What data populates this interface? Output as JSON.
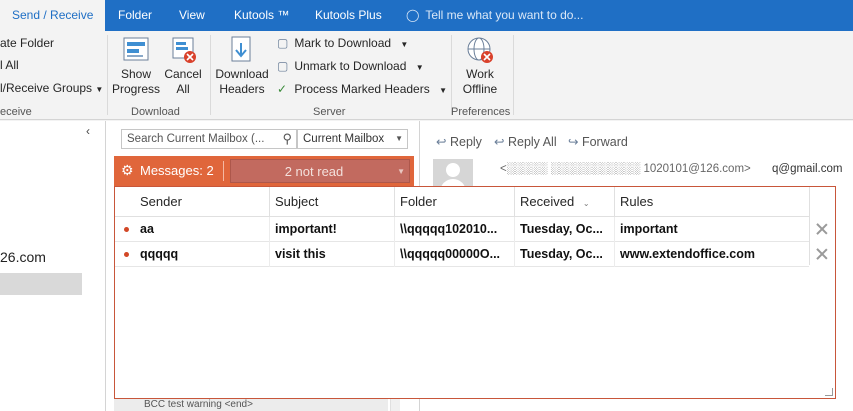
{
  "tabs": [
    {
      "label": "Send / Receive",
      "active": true
    },
    {
      "label": "Folder"
    },
    {
      "label": "View"
    },
    {
      "label": "Kutools ™"
    },
    {
      "label": "Kutools Plus"
    }
  ],
  "tell_me": "Tell me what you want to do...",
  "ribbon": {
    "create_folder": "ate Folder",
    "send_all": "l All",
    "receive_groups": "l/Receive Groups",
    "receive_group_label": "eceive",
    "show_progress_1": "Show",
    "show_progress_2": "Progress",
    "cancel_all_1": "Cancel",
    "cancel_all_2": "All",
    "download_group": "Download",
    "download_headers_1": "Download",
    "download_headers_2": "Headers",
    "mark_to_download": "Mark to Download",
    "unmark_to_download": "Unmark to Download",
    "process_marked_headers": "Process Marked Headers",
    "server_group": "Server",
    "work_offline_1": "Work",
    "work_offline_2": "Offline",
    "preferences_group": "Preferences"
  },
  "left_pane": {
    "account_suffix": "26.com"
  },
  "search": {
    "placeholder": "Search Current Mailbox (...",
    "scope": "Current Mailbox"
  },
  "reading": {
    "reply": "Reply",
    "reply_all": "Reply All",
    "forward": "Forward",
    "recipient": "q@gmail.com",
    "sender_blurred": "<░░░░░ ░░░░░░░░░░░ 1020101@126.com>"
  },
  "kutools_panel": {
    "title": "Messages: 2",
    "filter_value": "2 not read",
    "columns": [
      "Sender",
      "Subject",
      "Folder",
      "Received",
      "Rules"
    ],
    "rows": [
      {
        "sender": "aa",
        "subject": "important!",
        "folder": "\\\\qqqqq102010...",
        "received": "Tuesday, Oc...",
        "rules": "important"
      },
      {
        "sender": "qqqqq",
        "subject": "visit this",
        "folder": "\\\\qqqqq00000O...",
        "received": "Tuesday, Oc...",
        "rules": "www.extendoffice.com"
      }
    ]
  },
  "mail_list_peek": "BCC test warning <end>",
  "colors": {
    "accent": "#1f6fc5",
    "kutools_orange": "#e0663b",
    "unread_dot": "#d24726"
  }
}
